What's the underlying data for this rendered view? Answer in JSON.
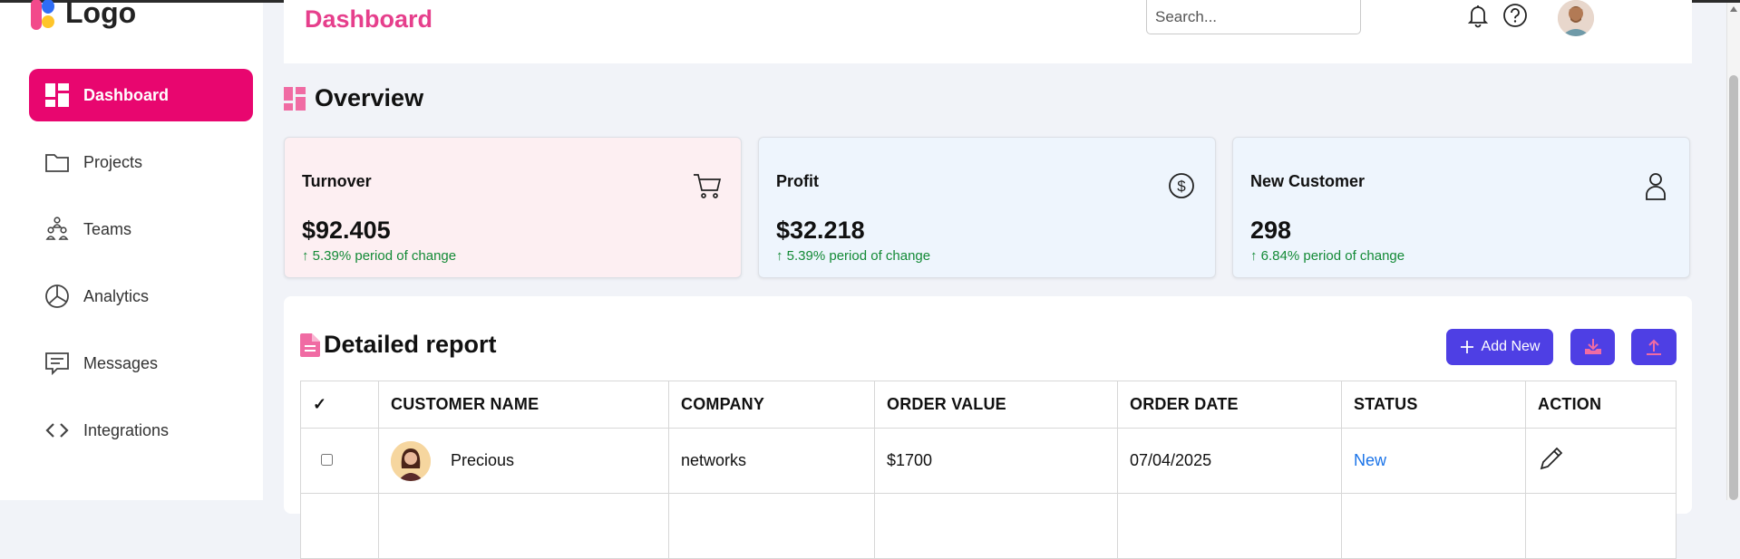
{
  "app": {
    "logo_text": "Logo",
    "accent": "#e8066f",
    "title_color": "#e63f8c",
    "button_color": "#4e3fe4"
  },
  "sidebar": {
    "items": [
      {
        "label": "Dashboard",
        "icon": "dashboard-icon",
        "active": true
      },
      {
        "label": "Projects",
        "icon": "folder-icon"
      },
      {
        "label": "Teams",
        "icon": "team-icon"
      },
      {
        "label": "Analytics",
        "icon": "pie-chart-icon"
      },
      {
        "label": "Messages",
        "icon": "message-icon"
      },
      {
        "label": "Integrations",
        "icon": "code-icon"
      }
    ]
  },
  "header": {
    "title": "Dashboard",
    "search_placeholder": "Search...",
    "icons": [
      "bell-icon",
      "help-icon",
      "avatar"
    ]
  },
  "overview": {
    "title": "Overview",
    "cards": [
      {
        "title": "Turnover",
        "value": "$92.405",
        "change": "↑ 5.39% period of change",
        "icon": "cart-icon",
        "bg": "#fdeff2"
      },
      {
        "title": "Profit",
        "value": "$32.218",
        "change": "↑ 5.39% period of change",
        "icon": "dollar-icon",
        "bg": "#eef5fd"
      },
      {
        "title": "New Customer",
        "value": "298",
        "change": "↑ 6.84% period of change",
        "icon": "user-icon",
        "bg": "#eef5fd"
      }
    ]
  },
  "report": {
    "title": "Detailed report",
    "add_new_label": "Add New",
    "import_icon": "import-icon",
    "export_icon": "export-icon",
    "columns": [
      "✓",
      "CUSTOMER NAME",
      "COMPANY",
      "ORDER VALUE",
      "ORDER DATE",
      "STATUS",
      "ACTION"
    ],
    "rows": [
      {
        "customer": "Precious",
        "company": "networks",
        "order_value": "$1700",
        "order_date": "07/04/2025",
        "status": "New",
        "action_icon": "pencil-icon"
      }
    ]
  }
}
